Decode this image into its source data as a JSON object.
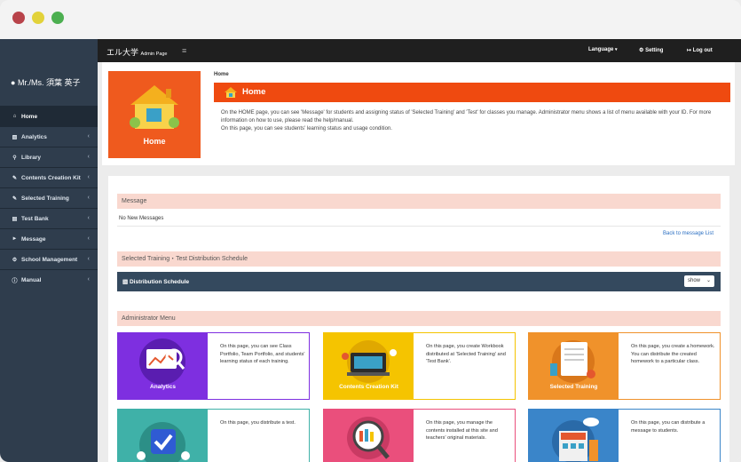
{
  "user": {
    "name": "Mr./Ms. 須葉 英子"
  },
  "sidebar": {
    "items": [
      {
        "label": "Home",
        "icon": "home-icon",
        "active": true
      },
      {
        "label": "Analytics",
        "icon": "bar-chart-icon"
      },
      {
        "label": "Library",
        "icon": "search-icon"
      },
      {
        "label": "Contents Creation Kit",
        "icon": "pencil-icon"
      },
      {
        "label": "Selected Training",
        "icon": "pencil-icon"
      },
      {
        "label": "Test Bank",
        "icon": "list-icon"
      },
      {
        "label": "Message",
        "icon": "megaphone-icon"
      },
      {
        "label": "School Management",
        "icon": "gear-icon"
      },
      {
        "label": "Manual",
        "icon": "info-icon"
      }
    ]
  },
  "topbar": {
    "brand": "エル大学",
    "brand_sub": "Admin Page",
    "language": "Language",
    "setting": "Setting",
    "logout": "Log out"
  },
  "home": {
    "tile_label": "Home",
    "breadcrumb": "Home",
    "title": "Home",
    "description_1": "On the HOME page, you can see 'Message' for students and assigning status of 'Selected Training' and 'Test' for classes you manage. Administrator menu shows a list of menu available with your ID. For more information on how to use, please read the help/manual.",
    "description_2": "On this page, you can see students' learning status and usage condition."
  },
  "message": {
    "heading": "Message",
    "empty": "No New Messages",
    "back_link": "Back to message List"
  },
  "schedule": {
    "heading": "Selected Training・Test Distribution Schedule",
    "bar_label": "Distribution Schedule",
    "select_value": "show"
  },
  "admin_menu": {
    "heading": "Administrator Menu",
    "cards": [
      {
        "caption": "Analytics",
        "text": "On this page, you can see Class Portfolio, Team Portfolio, and students' learning status of each training.",
        "color": "#7e2fe0",
        "border": "#7e2fe0"
      },
      {
        "caption": "Contents Creation Kit",
        "text": "On this page, you create Workbook distributed at 'Selected Training' and 'Test Bank'.",
        "color": "#f5c400",
        "border": "#f5c400"
      },
      {
        "caption": "Selected Training",
        "text": "On this page, you create a homework. You can distribute the created homework to a particular class.",
        "color": "#f0922b",
        "border": "#f0922b"
      },
      {
        "caption": "",
        "text": "On this page, you distribute a test.",
        "color": "#3fb1a8",
        "border": "#3fb1a8"
      },
      {
        "caption": "",
        "text": "On this page, you manage the contents installed at this site and teachers' original materials.",
        "color": "#ea4f7c",
        "border": "#ea4f7c"
      },
      {
        "caption": "",
        "text": "On this page, you can distribute a message to students.",
        "color": "#3a85c9",
        "border": "#3a85c9"
      }
    ]
  }
}
